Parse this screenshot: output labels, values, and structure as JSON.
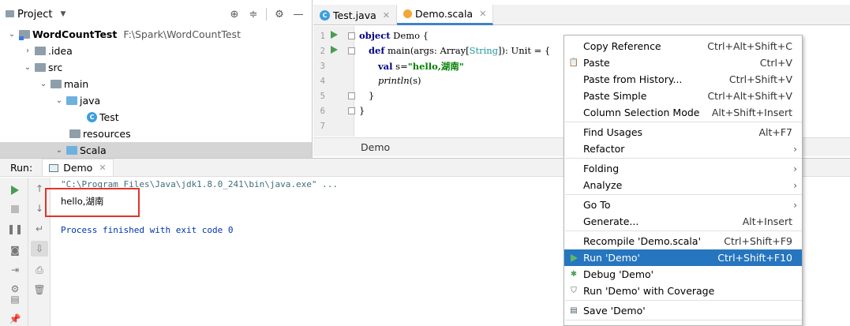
{
  "project": {
    "title": "Project",
    "tree": [
      {
        "label": "WordCountTest",
        "path": "F:\\Spark\\WordCountTest"
      },
      {
        "label": ".idea"
      },
      {
        "label": "src"
      },
      {
        "label": "main"
      },
      {
        "label": "java"
      },
      {
        "label": "Test"
      },
      {
        "label": "resources"
      },
      {
        "label": "Scala"
      }
    ]
  },
  "tabs": [
    {
      "label": "Test.java"
    },
    {
      "label": "Demo.scala"
    }
  ],
  "editor": {
    "line_numbers": [
      "1",
      "2",
      "3",
      "4",
      "5",
      "6",
      "7"
    ],
    "lines": {
      "l1_kw": "object",
      "l1_rest": " Demo {",
      "l2_kw": "def",
      "l2_a": " main(args: Array[",
      "l2_type": "String",
      "l2_b": "]): Unit = {",
      "l3_kw": "val",
      "l3_a": " s=",
      "l3_str": "\"hello,湖南\"",
      "l4_fn": "println",
      "l4_rest": "(s)",
      "l5": "}",
      "l6": "}"
    },
    "breadcrumb": "Demo"
  },
  "run_panel": {
    "label": "Run:",
    "tab": "Demo",
    "output": {
      "cmd": "\"C:\\Program Files\\Java\\jdk1.8.0_241\\bin\\java.exe\" ...",
      "line1": "hello,湖南",
      "finish": "Process finished with exit code 0"
    }
  },
  "context_menu": {
    "items": [
      {
        "label": "Copy Reference",
        "shortcut": "Ctrl+Alt+Shift+C"
      },
      {
        "label": "Paste",
        "shortcut": "Ctrl+V"
      },
      {
        "label": "Paste from History...",
        "shortcut": "Ctrl+Shift+V"
      },
      {
        "label": "Paste Simple",
        "shortcut": "Ctrl+Alt+Shift+V"
      },
      {
        "label": "Column Selection Mode",
        "shortcut": "Alt+Shift+Insert"
      },
      {
        "label": "Find Usages",
        "shortcut": "Alt+F7"
      },
      {
        "label": "Refactor",
        "shortcut": ""
      },
      {
        "label": "Folding",
        "shortcut": ""
      },
      {
        "label": "Analyze",
        "shortcut": ""
      },
      {
        "label": "Go To",
        "shortcut": ""
      },
      {
        "label": "Generate...",
        "shortcut": "Alt+Insert"
      },
      {
        "label": "Recompile 'Demo.scala'",
        "shortcut": "Ctrl+Shift+F9"
      },
      {
        "label": "Run 'Demo'",
        "shortcut": "Ctrl+Shift+F10"
      },
      {
        "label": "Debug 'Demo'",
        "shortcut": ""
      },
      {
        "label": "Run 'Demo' with Coverage",
        "shortcut": ""
      },
      {
        "label": "Save 'Demo'",
        "shortcut": ""
      }
    ]
  },
  "colors": {
    "menu_highlight": "#2675bf",
    "run_green": "#499c54",
    "annotation_red": "#e3332a"
  }
}
